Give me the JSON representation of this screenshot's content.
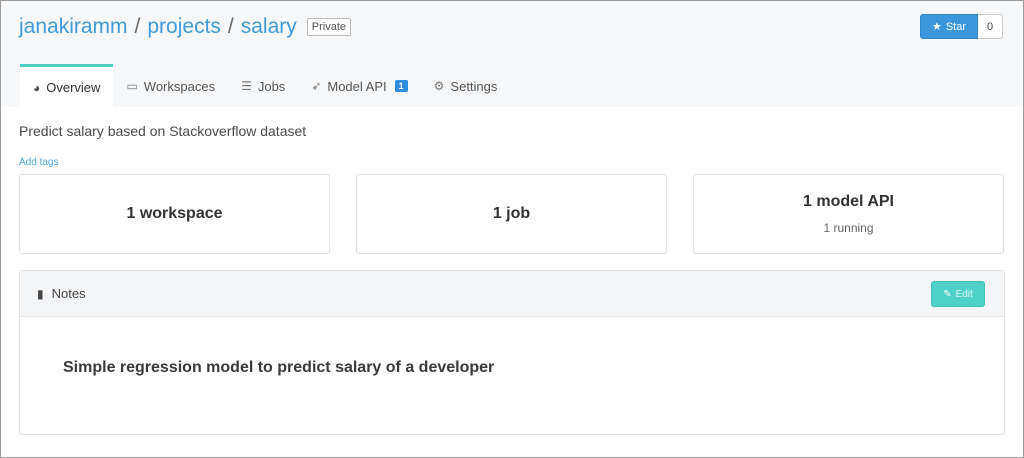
{
  "breadcrumb": {
    "owner": "janakiramm",
    "section": "projects",
    "project": "salary",
    "separator": "/",
    "visibility": "Private"
  },
  "star": {
    "label": "Star",
    "count": "0",
    "icon": "star-icon"
  },
  "tabs": [
    {
      "label": "Overview",
      "icon": "dashboard-icon",
      "active": true
    },
    {
      "label": "Workspaces",
      "icon": "laptop-icon"
    },
    {
      "label": "Jobs",
      "icon": "list-icon"
    },
    {
      "label": "Model API",
      "icon": "rocket-icon",
      "badge": "1"
    },
    {
      "label": "Settings",
      "icon": "gear-icon"
    }
  ],
  "description": "Predict salary based on Stackoverflow dataset",
  "add_tags": "Add tags",
  "cards": [
    {
      "title": "1 workspace"
    },
    {
      "title": "1 job"
    },
    {
      "title": "1 model API",
      "subtitle": "1 running"
    }
  ],
  "notes": {
    "title": "Notes",
    "edit_label": "Edit",
    "body": "Simple regression model to predict salary of a developer"
  },
  "colors": {
    "link": "#3f9bd9",
    "accent_teal": "#4fd0c9",
    "star_blue": "#3b96db"
  }
}
